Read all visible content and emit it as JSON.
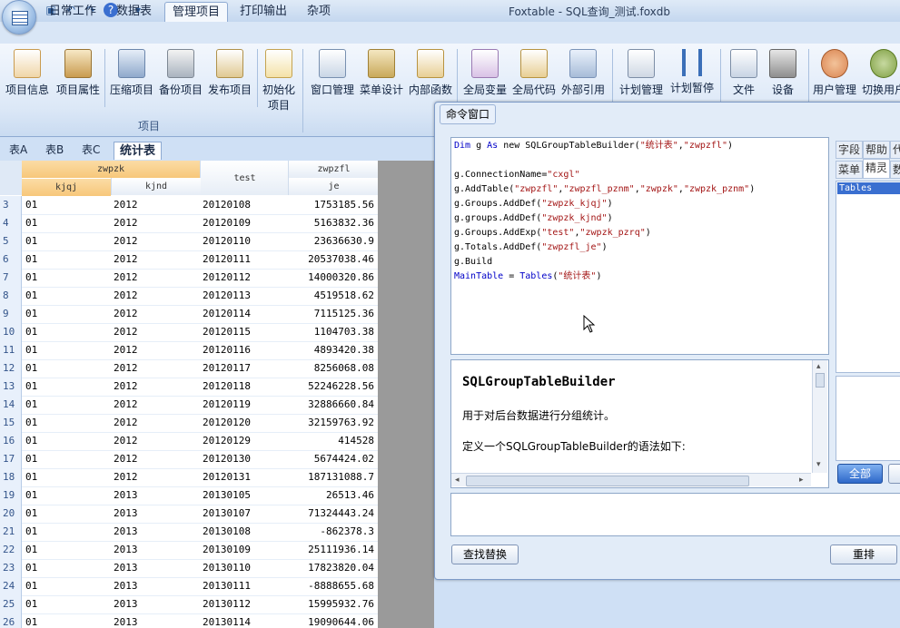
{
  "window": {
    "title": "Foxtable - SQL查询_测试.foxdb"
  },
  "ribbon_tabs": [
    "日常工作",
    "数据表",
    "管理项目",
    "打印输出",
    "杂项"
  ],
  "ribbon_groups": {
    "project": {
      "label": "项目",
      "buttons": [
        "项目信息",
        "项目属性",
        "压缩项目",
        "备份项目",
        "发布项目",
        "初始化项目"
      ]
    },
    "tools": {
      "buttons": [
        "窗口管理",
        "菜单设计",
        "内部函数",
        "全局变量",
        "全局代码",
        "外部引用",
        "计划管理",
        "计划暂停",
        "文件",
        "设备",
        "用户管理",
        "切换用户"
      ]
    }
  },
  "sheet_tabs": [
    "表A",
    "表B",
    "表C",
    "统计表"
  ],
  "grid": {
    "group_headers": [
      "zwpzk",
      "test",
      "zwpzfl"
    ],
    "columns": [
      "kjqj",
      "kjnd",
      "je"
    ],
    "rows": [
      {
        "n": "3",
        "a": "01",
        "b": "2012",
        "c": "20120108",
        "d": "1753185.56"
      },
      {
        "n": "4",
        "a": "01",
        "b": "2012",
        "c": "20120109",
        "d": "5163832.36"
      },
      {
        "n": "5",
        "a": "01",
        "b": "2012",
        "c": "20120110",
        "d": "23636630.9"
      },
      {
        "n": "6",
        "a": "01",
        "b": "2012",
        "c": "20120111",
        "d": "20537038.46"
      },
      {
        "n": "7",
        "a": "01",
        "b": "2012",
        "c": "20120112",
        "d": "14000320.86"
      },
      {
        "n": "8",
        "a": "01",
        "b": "2012",
        "c": "20120113",
        "d": "4519518.62"
      },
      {
        "n": "9",
        "a": "01",
        "b": "2012",
        "c": "20120114",
        "d": "7115125.36"
      },
      {
        "n": "10",
        "a": "01",
        "b": "2012",
        "c": "20120115",
        "d": "1104703.38"
      },
      {
        "n": "11",
        "a": "01",
        "b": "2012",
        "c": "20120116",
        "d": "4893420.38"
      },
      {
        "n": "12",
        "a": "01",
        "b": "2012",
        "c": "20120117",
        "d": "8256068.08"
      },
      {
        "n": "13",
        "a": "01",
        "b": "2012",
        "c": "20120118",
        "d": "52246228.56"
      },
      {
        "n": "14",
        "a": "01",
        "b": "2012",
        "c": "20120119",
        "d": "32886660.84"
      },
      {
        "n": "15",
        "a": "01",
        "b": "2012",
        "c": "20120120",
        "d": "32159763.92"
      },
      {
        "n": "16",
        "a": "01",
        "b": "2012",
        "c": "20120129",
        "d": "414528"
      },
      {
        "n": "17",
        "a": "01",
        "b": "2012",
        "c": "20120130",
        "d": "5674424.02"
      },
      {
        "n": "18",
        "a": "01",
        "b": "2012",
        "c": "20120131",
        "d": "187131088.7"
      },
      {
        "n": "19",
        "a": "01",
        "b": "2013",
        "c": "20130105",
        "d": "26513.46"
      },
      {
        "n": "20",
        "a": "01",
        "b": "2013",
        "c": "20130107",
        "d": "71324443.24"
      },
      {
        "n": "21",
        "a": "01",
        "b": "2013",
        "c": "20130108",
        "d": "-862378.3"
      },
      {
        "n": "22",
        "a": "01",
        "b": "2013",
        "c": "20130109",
        "d": "25111936.14"
      },
      {
        "n": "23",
        "a": "01",
        "b": "2013",
        "c": "20130110",
        "d": "17823820.04"
      },
      {
        "n": "24",
        "a": "01",
        "b": "2013",
        "c": "20130111",
        "d": "-8888655.68"
      },
      {
        "n": "25",
        "a": "01",
        "b": "2013",
        "c": "20130112",
        "d": "15995932.76"
      },
      {
        "n": "26",
        "a": "01",
        "b": "2013",
        "c": "20130114",
        "d": "19090644.06"
      }
    ]
  },
  "command_window": {
    "title": "命令窗口",
    "code": [
      "Dim g As new SQLGroupTableBuilder(\"统计表\",\"zwpzfl\")",
      "",
      "g.ConnectionName=\"cxgl\"",
      "g.AddTable(\"zwpzfl\",\"zwpzfl_pznm\",\"zwpzk\",\"zwpzk_pznm\")",
      "g.Groups.AddDef(\"zwpzk_kjqj\")",
      "g.groups.AddDef(\"zwpzk_kjnd\")",
      "g.Groups.AddExp(\"test\",\"zwpzk_pzrq\")",
      "g.Totals.AddDef(\"zwpzfl_je\")",
      "g.Build",
      "MainTable = Tables(\"统计表\")"
    ],
    "help": {
      "title": "SQLGroupTableBuilder",
      "line1": "用于对后台数据进行分组统计。",
      "line2": "定义一个SQLGroupTableBuilder的语法如下:"
    },
    "buttons": {
      "find_replace": "查找替换",
      "rearrange": "重排",
      "all": "全部"
    },
    "side_tabs": [
      "字段",
      "帮助",
      "代",
      "菜单",
      "精灵",
      "数"
    ],
    "side_list_selected": "Tables"
  }
}
